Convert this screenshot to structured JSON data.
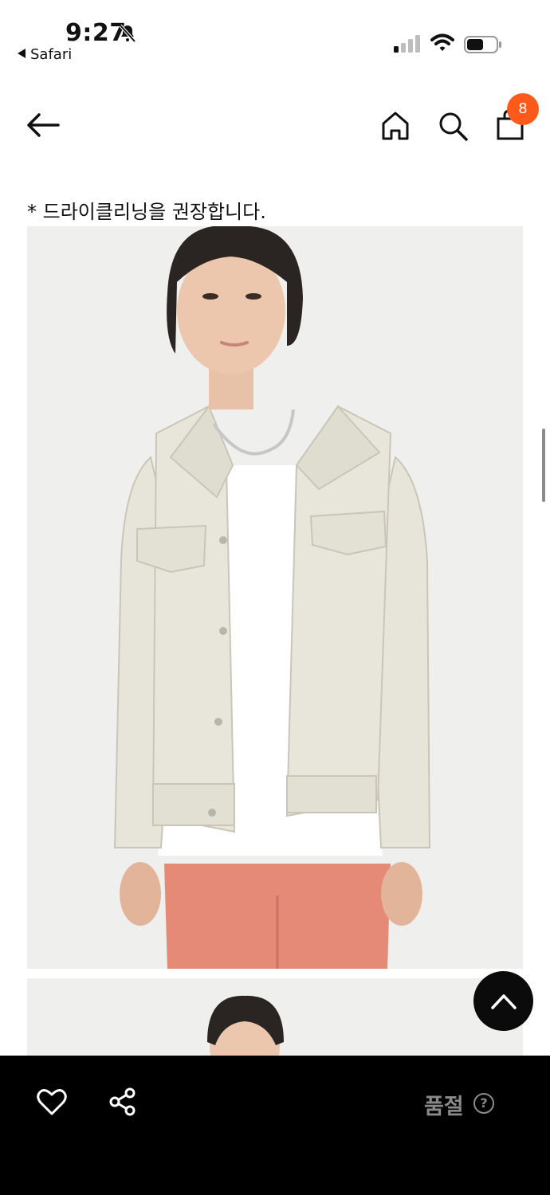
{
  "status_bar": {
    "time": "9:27",
    "back_app": "Safari",
    "bell_icon": "bell-slash-icon",
    "signal_icon": "cellular-signal-icon",
    "wifi_icon": "wifi-icon",
    "battery_icon": "battery-icon"
  },
  "nav": {
    "back_icon": "arrow-left-icon",
    "home_icon": "home-icon",
    "search_icon": "search-icon",
    "bag_icon": "shopping-bag-icon",
    "bag_count": "8",
    "badge_color": "#ff5a1a"
  },
  "content": {
    "care_note": "* 드라이클리닝을 권장합니다.",
    "images": [
      "model-wearing-ivory-jacket-photo",
      "model-second-photo"
    ]
  },
  "scroll_top": {
    "icon": "chevron-up-icon"
  },
  "bottom_bar": {
    "favorite_icon": "heart-icon",
    "share_icon": "share-icon",
    "status_label": "품절",
    "help_icon": "?",
    "label_color": "#8a8a8a"
  }
}
